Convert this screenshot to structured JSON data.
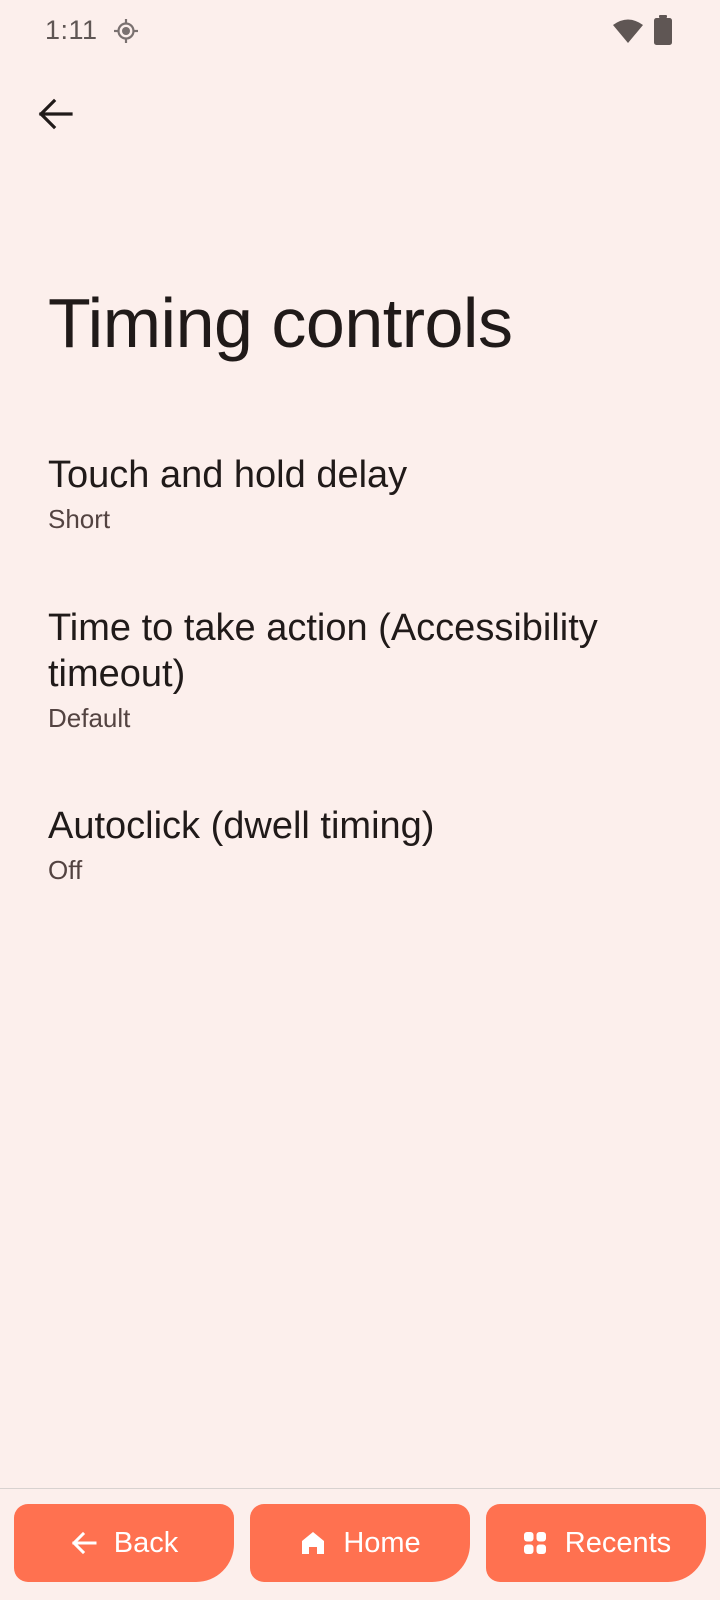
{
  "status_bar": {
    "time": "1:11",
    "icons": [
      "gps-icon",
      "wifi-icon",
      "battery-icon"
    ]
  },
  "toolbar": {
    "back_icon": "arrow-back-icon"
  },
  "page": {
    "title": "Timing controls"
  },
  "settings": [
    {
      "title": "Touch and hold delay",
      "summary": "Short"
    },
    {
      "title": "Time to take action (Accessibility timeout)",
      "summary": "Default"
    },
    {
      "title": "Autoclick (dwell timing)",
      "summary": "Off"
    }
  ],
  "nav_bar": {
    "back_label": "Back",
    "home_label": "Home",
    "recents_label": "Recents",
    "button_color": "#ff7150"
  },
  "colors": {
    "background": "#fcefec",
    "text_primary": "#201a19",
    "text_secondary": "#534341"
  }
}
